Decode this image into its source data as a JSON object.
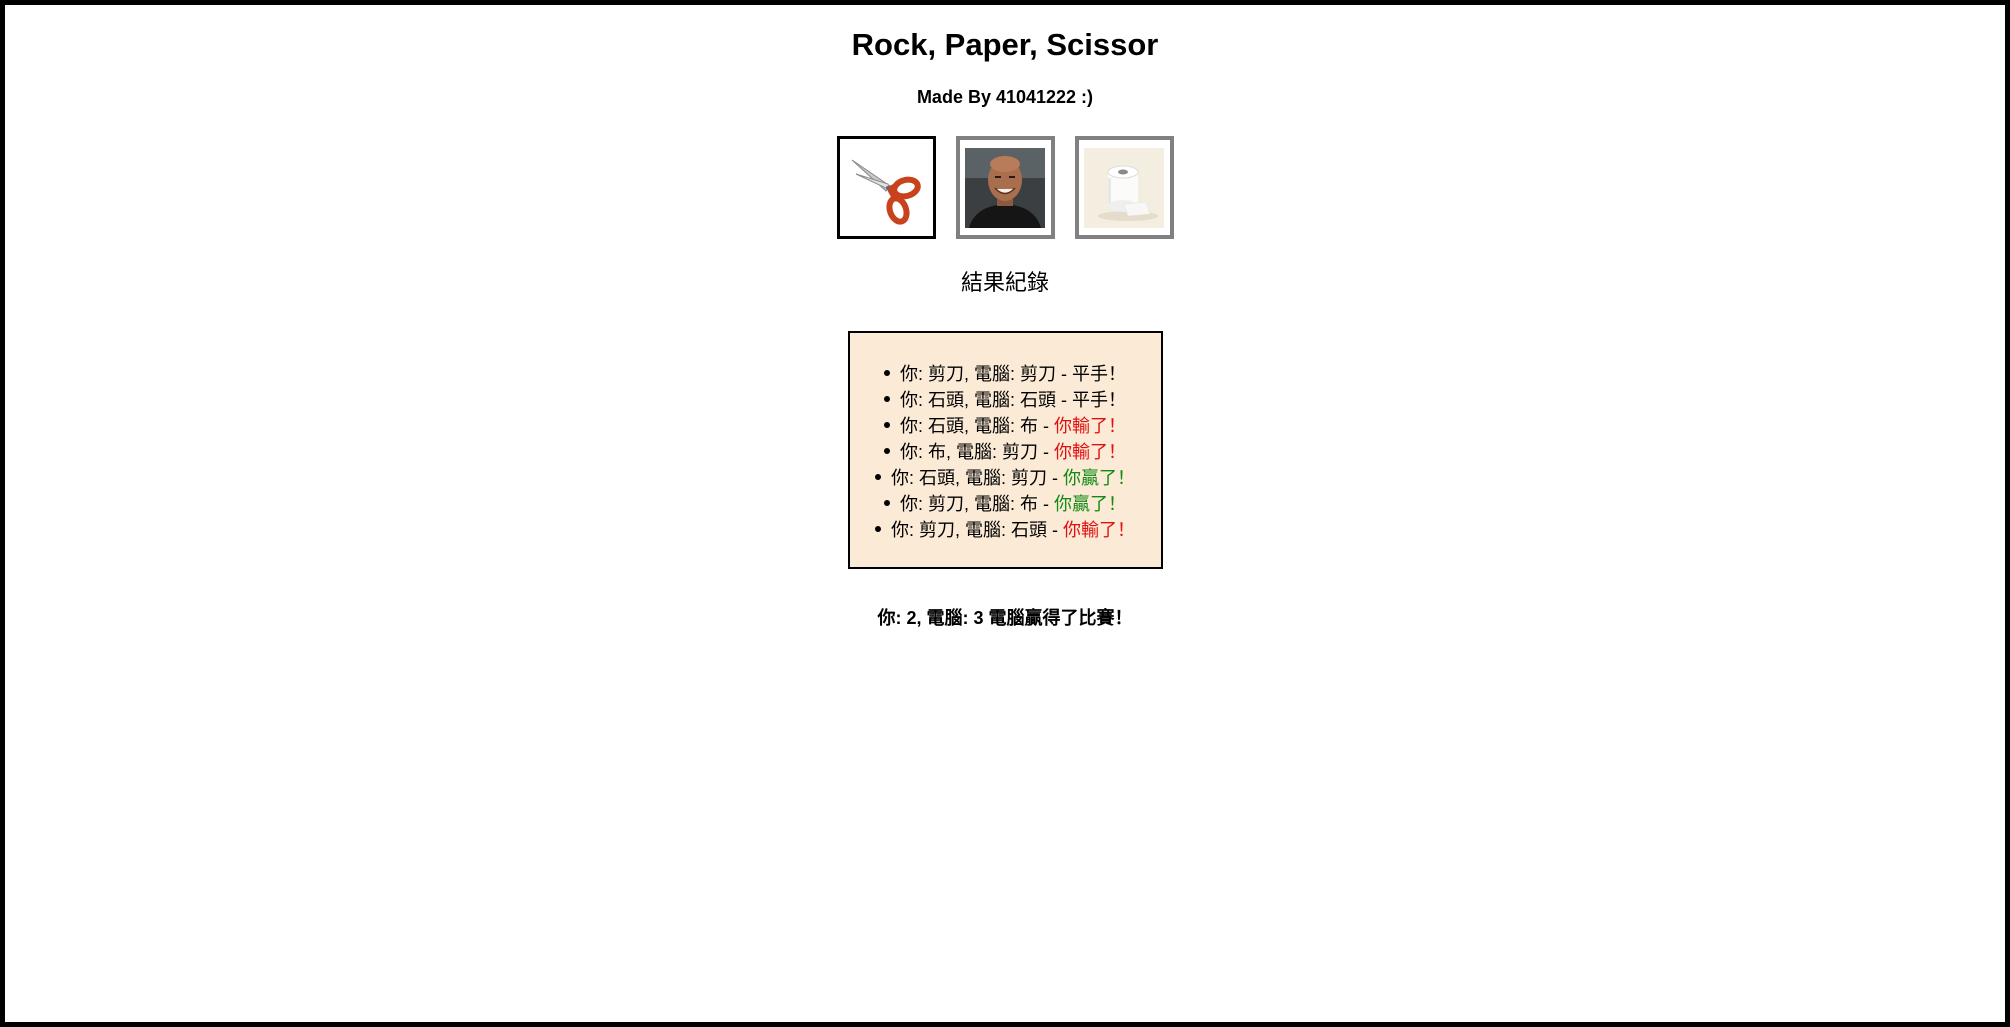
{
  "header": {
    "title": "Rock, Paper, Scissor",
    "subtitle": "Made By 41041222 :)"
  },
  "choices": [
    {
      "name": "scissors",
      "icon": "scissors-icon",
      "selected": true
    },
    {
      "name": "rock",
      "icon": "rock-face-photo",
      "selected": false
    },
    {
      "name": "paper",
      "icon": "toilet-paper-icon",
      "selected": false
    }
  ],
  "log": {
    "heading": "結果紀錄",
    "entries": [
      {
        "text": "你: 剪刀, 電腦: 剪刀 - ",
        "result": "平手！",
        "type": "draw"
      },
      {
        "text": "你: 石頭, 電腦: 石頭 - ",
        "result": "平手！",
        "type": "draw"
      },
      {
        "text": "你: 石頭, 電腦: 布 - ",
        "result": "你輸了！",
        "type": "lose"
      },
      {
        "text": "你: 布, 電腦: 剪刀 - ",
        "result": "你輸了！",
        "type": "lose"
      },
      {
        "text": "你: 石頭, 電腦: 剪刀 - ",
        "result": "你贏了！",
        "type": "win"
      },
      {
        "text": "你: 剪刀, 電腦: 布 - ",
        "result": "你贏了！",
        "type": "win"
      },
      {
        "text": "你: 剪刀, 電腦: 石頭 - ",
        "result": "你輸了！",
        "type": "lose"
      }
    ]
  },
  "score": {
    "text": "你: 2, 電腦: 3 電腦贏得了比賽！"
  },
  "colors": {
    "lose": "#e01010",
    "win": "#108a10",
    "log_background": "#fbead6"
  }
}
